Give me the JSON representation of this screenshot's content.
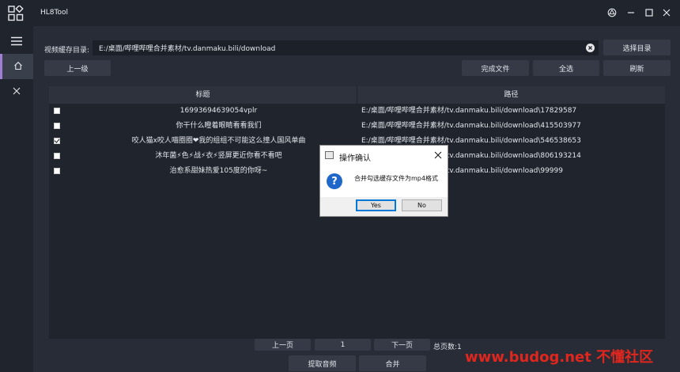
{
  "app": {
    "title": "HL8Tool"
  },
  "sidebar": {
    "items": [
      {
        "icon": "home-icon"
      },
      {
        "icon": "close-icon"
      }
    ]
  },
  "toolbar": {
    "dir_label": "视频缓存目录:",
    "dir_value": "E:/桌面/哔哩哔哩合并素材/tv.danmaku.bili/download",
    "select_dir": "选择目录",
    "up_level": "上一级",
    "done_files": "完成文件",
    "select_all": "全选",
    "refresh": "刷新"
  },
  "table": {
    "headers": [
      "标题",
      "路径"
    ],
    "rows": [
      {
        "checked": false,
        "title": "16993694639054vplr",
        "path": "E:/桌面/哔哩哔哩合并素材/tv.danmaku.bili/download\\17829587"
      },
      {
        "checked": false,
        "title": "你干什么瞪着眼睛看看我们",
        "path": "E:/桌面/哔哩哔哩合并素材/tv.danmaku.bili/download\\415503977"
      },
      {
        "checked": true,
        "title": "咬人猫x咬人喵圈圈❤我的组组不可能这么撞人国风单曲",
        "path": "E:/桌面/哔哩哔哩合并素材/tv.danmaku.bili/download\\546538653"
      },
      {
        "checked": false,
        "title": "沐年菌⚡色⚡战⚡衣⚡竖屏更近你看不看吧",
        "path": "E:/桌面/哔哩哔哩合并素材/tv.danmaku.bili/download\\806193214"
      },
      {
        "checked": false,
        "title": "治愈系甜妹热爱105度的你呀~",
        "path": "E:/桌面/哔哩哔哩合并素材/tv.danmaku.bili/download\\99999"
      }
    ]
  },
  "pager": {
    "prev": "上一页",
    "page": "1",
    "next": "下一页",
    "total": "总页数:1"
  },
  "actions": {
    "extract_audio": "提取音频",
    "merge": "合并"
  },
  "dialog": {
    "title": "操作确认",
    "message": "合并勾选缓存文件为mp4格式",
    "yes": "Yes",
    "no": "No"
  },
  "watermark": "www.budog.net 不懂社区"
}
